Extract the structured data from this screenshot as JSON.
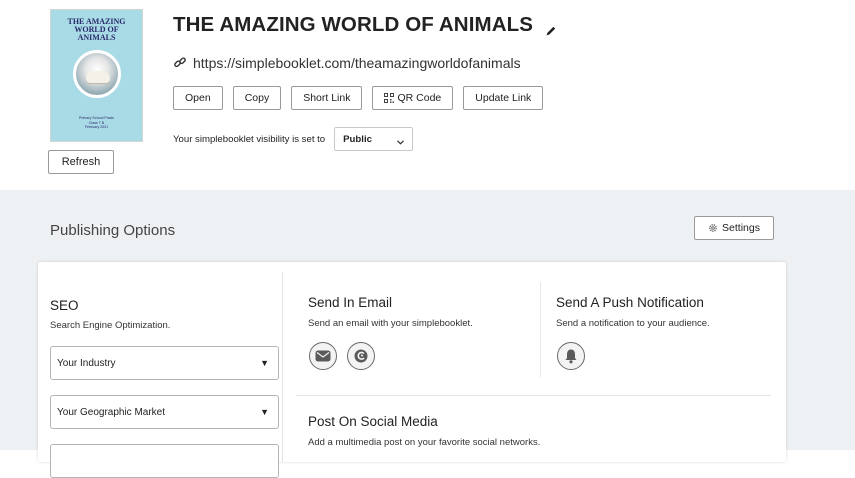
{
  "header": {
    "cover": {
      "title": "THE AMAZING\nWORLD OF\nANIMALS",
      "subtitle": "Primary School Prade\nClass 7 B\nFebruary 2021",
      "bg_color": "#a8dbe6"
    },
    "refresh_label": "Refresh",
    "title": "THE AMAZING WORLD OF ANIMALS",
    "url": "https://simplebooklet.com/theamazingworldofanimals",
    "buttons": {
      "open": "Open",
      "copy": "Copy",
      "short_link": "Short Link",
      "qr_code": "QR Code",
      "update_link": "Update Link"
    },
    "visibility_label": "Your simplebooklet visibility is set to",
    "visibility_value": "Public"
  },
  "publishing": {
    "title": "Publishing Options",
    "settings_label": "Settings",
    "seo": {
      "title": "SEO",
      "desc": "Search Engine Optimization.",
      "industry_placeholder": "Your Industry",
      "market_placeholder": "Your Geographic Market"
    },
    "email": {
      "title": "Send In Email",
      "desc": "Send an email with your simplebooklet."
    },
    "push": {
      "title": "Send A Push Notification",
      "desc": "Send a notification to your audience."
    },
    "social": {
      "title": "Post On Social Media",
      "desc": "Add a multimedia post on your favorite social networks."
    }
  }
}
